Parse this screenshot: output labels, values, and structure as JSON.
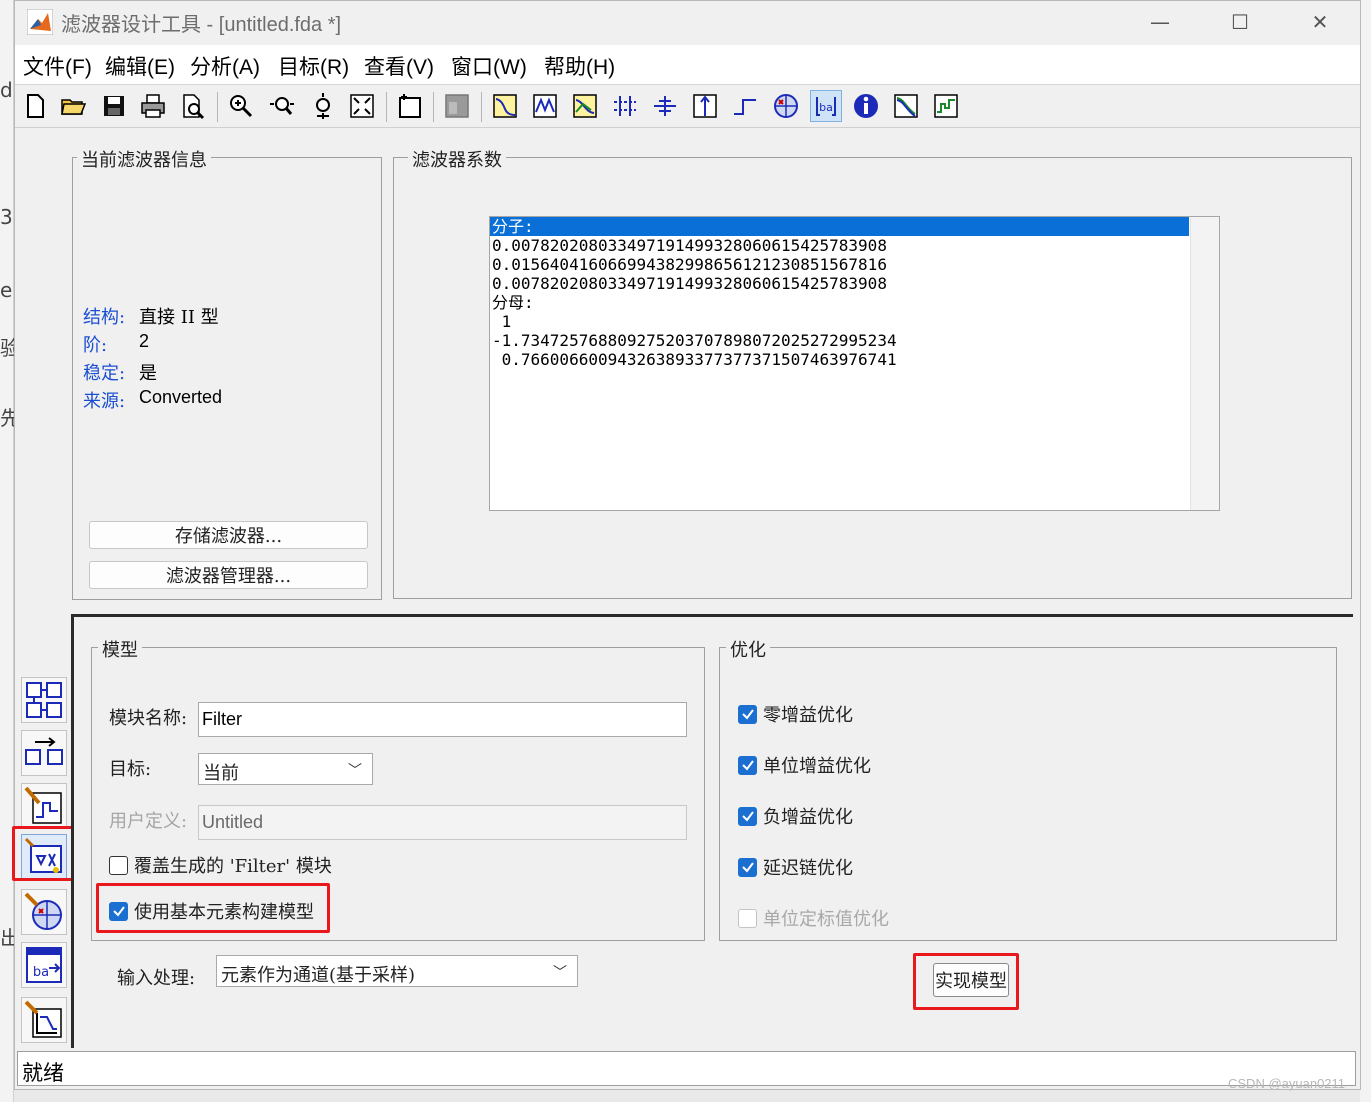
{
  "background_app": {
    "left_fragments": [
      "d",
      "3",
      "ep",
      "验",
      "先",
      "出"
    ]
  },
  "window": {
    "title": "滤波器设计工具 -  [untitled.fda *]",
    "controls": {
      "minimize": "—",
      "maximize": "☐",
      "close": "✕"
    }
  },
  "menu": [
    "文件(F)",
    "编辑(E)",
    "分析(A)",
    "目标(R)",
    "查看(V)",
    "窗口(W)",
    "帮助(H)"
  ],
  "toolbar_icons": [
    "new-file-icon",
    "open-folder-icon",
    "save-icon",
    "print-icon",
    "print-preview-icon",
    "zoom-in-icon",
    "zoom-x-icon",
    "zoom-y-icon",
    "full-view-icon",
    "new-window-icon",
    "design-mode-icon",
    "magnitude-response-icon",
    "phase-response-icon",
    "magnitude-phase-icon",
    "group-delay-icon",
    "phase-delay-icon",
    "impulse-response-icon",
    "step-response-icon",
    "pole-zero-icon",
    "coefficients-icon",
    "info-icon",
    "magnitude-estimate-icon",
    "round-off-noise-icon"
  ],
  "current_filter": {
    "title": "当前滤波器信息",
    "rows": [
      {
        "label": "结构:",
        "value": "直接 II 型"
      },
      {
        "label": "阶:",
        "value": "2"
      },
      {
        "label": "稳定:",
        "value": "是"
      },
      {
        "label": "来源:",
        "value": "Converted"
      }
    ],
    "store_button": "存储滤波器...",
    "manager_button": "滤波器管理器..."
  },
  "coefficients": {
    "title": "滤波器系数",
    "lines": [
      "分子:",
      "0.0078202080334971914993280606154257839​08",
      "0.015640416066994382998656121230851567816",
      "0.0078202080334971914993280606154257839​08",
      "分母:",
      " 1",
      "-1.7347257688092752037078980720252729952​34",
      " 0.76600660094326389337737737150746397674​1"
    ]
  },
  "model": {
    "title": "模型",
    "block_name_label": "模块名称:",
    "block_name_value": "Filter",
    "target_label": "目标:",
    "target_value": "当前",
    "user_defined_label": "用户定义:",
    "user_defined_value": "Untitled",
    "overwrite_label": "覆盖生成的 'Filter' 模块",
    "overwrite_checked": false,
    "basic_elements_label": "使用基本元素构建模型",
    "basic_elements_checked": true
  },
  "optimization": {
    "title": "优化",
    "options": [
      {
        "label": "零增益优化",
        "checked": true,
        "enabled": true
      },
      {
        "label": "单位增益优化",
        "checked": true,
        "enabled": true
      },
      {
        "label": "负增益优化",
        "checked": true,
        "enabled": true
      },
      {
        "label": "延迟链优化",
        "checked": true,
        "enabled": true
      },
      {
        "label": "单位定标值优化",
        "checked": false,
        "enabled": false
      }
    ]
  },
  "input_processing": {
    "label": "输入处理:",
    "value": "元素作为通道(基于采样)"
  },
  "realize_button": "实现模型",
  "sidebar_icons": [
    "transform-filter-icon",
    "convert-structure-icon",
    "design-filter-icon",
    "realize-model-icon",
    "pole-zero-editor-icon",
    "import-filter-icon",
    "multirate-design-icon"
  ],
  "status": "就绪",
  "watermark": "CSDN @ayuan0211",
  "colors": {
    "accent": "#1a6fd0",
    "highlight_box": "#e8181d",
    "info_label": "#1b4fd1",
    "selection": "#0a6fd6"
  }
}
